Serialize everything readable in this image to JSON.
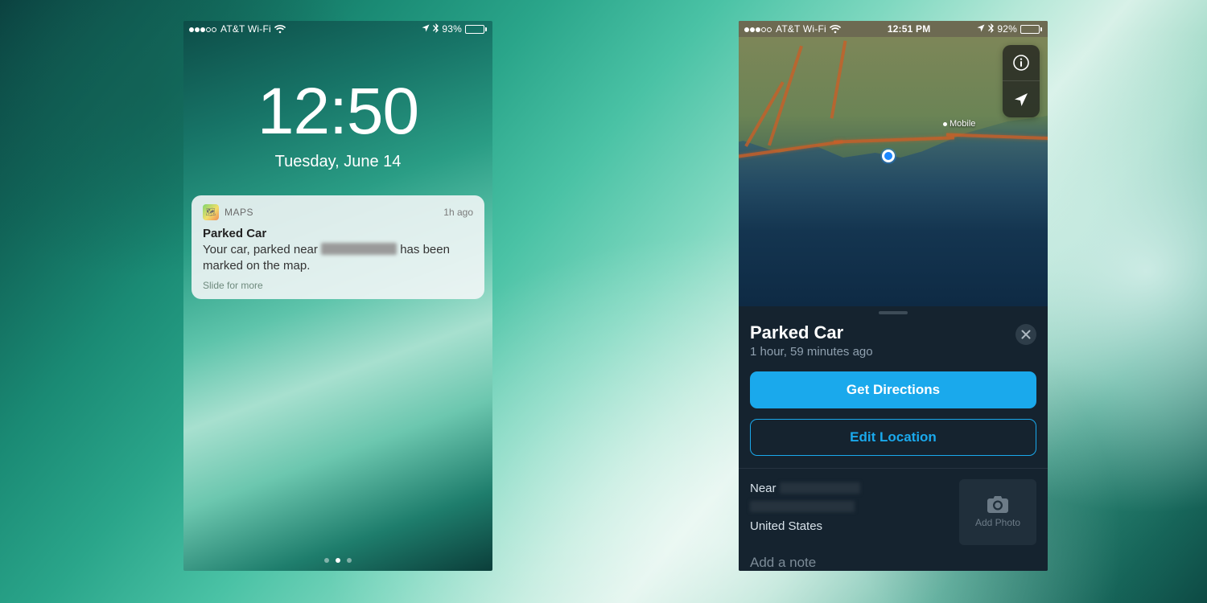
{
  "left": {
    "status": {
      "carrier": "AT&T Wi-Fi",
      "battery_pct": "93%",
      "battery_fill": 93
    },
    "clock_time": "12:50",
    "clock_date": "Tuesday, June 14",
    "notif": {
      "app": "MAPS",
      "ago": "1h ago",
      "title": "Parked Car",
      "body_pre": "Your car, parked near ",
      "body_post": " has been marked on the map.",
      "more": "Slide for more"
    }
  },
  "right": {
    "status": {
      "carrier": "AT&T Wi-Fi",
      "time": "12:51 PM",
      "battery_pct": "92%",
      "battery_fill": 92
    },
    "map": {
      "city_label": "Mobile"
    },
    "card": {
      "title": "Parked Car",
      "subtitle": "1 hour, 59 minutes ago",
      "directions": "Get Directions",
      "edit": "Edit Location",
      "near_label": "Near",
      "country": "United States",
      "add_photo": "Add Photo",
      "add_note": "Add a note"
    }
  }
}
